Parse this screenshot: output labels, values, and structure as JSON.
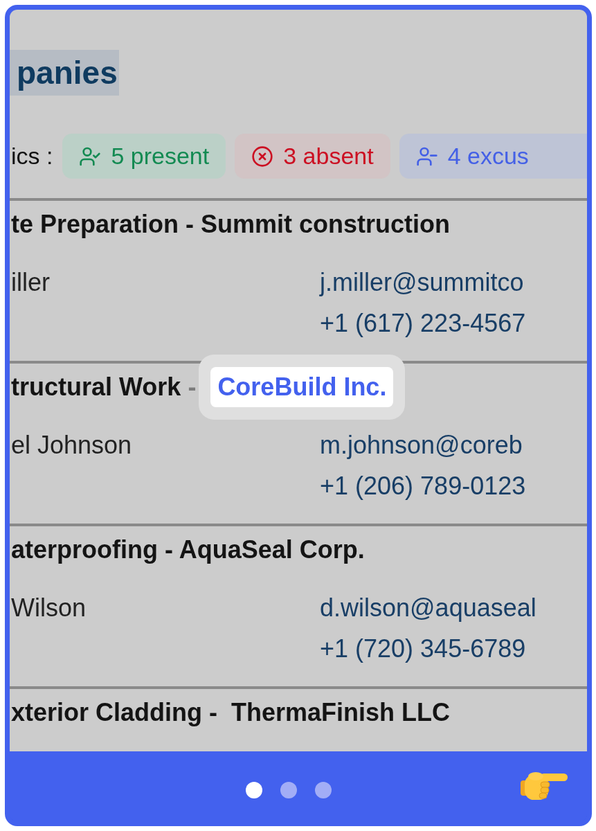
{
  "heading": {
    "text": "panies",
    "selected": true
  },
  "stats": {
    "label": "ics :",
    "chips": [
      {
        "kind": "present",
        "text": "5 present"
      },
      {
        "kind": "absent",
        "text": "3 absent"
      },
      {
        "kind": "excused",
        "text": "4 excus"
      }
    ]
  },
  "sections": [
    {
      "title": "te Preparation - Summit construction",
      "contact": {
        "name": "iller",
        "email": "j.miller@summitco",
        "phone": "+1 (617) 223-4567"
      }
    },
    {
      "title": "tructural Work",
      "separator": "-",
      "highlighted_company": "CoreBuild Inc.",
      "contact": {
        "name": "el Johnson",
        "email": "m.johnson@coreb",
        "phone": "+1 (206) 789-0123"
      }
    },
    {
      "title": "aterproofing - AquaSeal Corp.",
      "contact": {
        "name": "Wilson",
        "email": "d.wilson@aquaseal",
        "phone": "+1 (720) 345-6789"
      }
    },
    {
      "title": "xterior Cladding -  ThermaFinish LLC"
    }
  ],
  "pagination": [
    {
      "selected": true
    },
    {
      "selected": false
    },
    {
      "selected": false
    }
  ]
}
